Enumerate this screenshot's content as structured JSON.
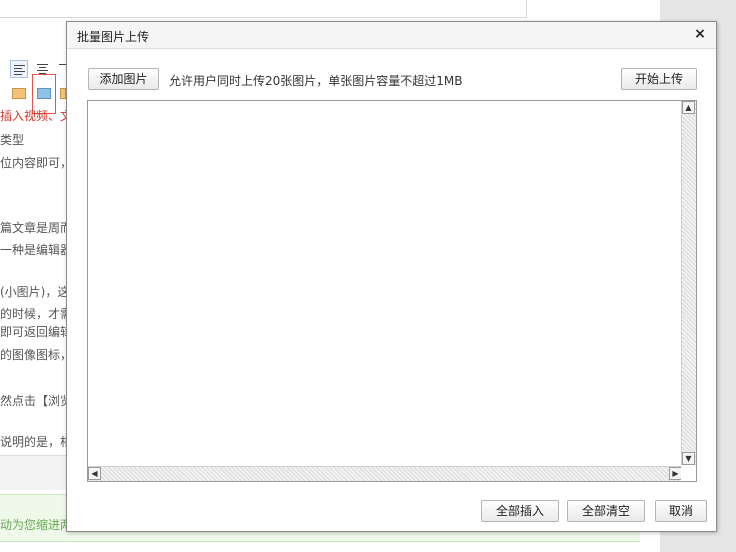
{
  "background": {
    "lines": [
      {
        "text": "插入视频、文件下载",
        "red": false
      },
      {
        "text": "类型",
        "red": false
      },
      {
        "text": "位内容即可，",
        "red": false
      },
      {
        "text": "篇文章是周而",
        "red": false
      },
      {
        "text": "一种是编辑器",
        "red": false
      },
      {
        "text": "(小图片)，这",
        "red": false
      },
      {
        "text": "的时候，才需",
        "red": false
      },
      {
        "text": "即可返回编辑",
        "red": false
      },
      {
        "text": "的图像图标，",
        "red": false
      },
      {
        "text": "然点击【浏览",
        "red": false
      },
      {
        "text": "说明的是，相",
        "red": false
      }
    ],
    "footer_text": "动为您缩进两"
  },
  "dialog": {
    "title": "批量图片上传",
    "close_symbol": "×",
    "add_button": "添加图片",
    "hint": "允许用户同时上传20张图片，单张图片容量不超过1MB",
    "start_button": "开始上传",
    "insert_all_button": "全部插入",
    "clear_all_button": "全部清空",
    "cancel_button": "取消"
  },
  "colors": {
    "dialog_border": "#8a8a8a",
    "title_bg": "#f5f5f5",
    "highlight_red": "#e0554e",
    "footer_green": "#eef9ea"
  }
}
